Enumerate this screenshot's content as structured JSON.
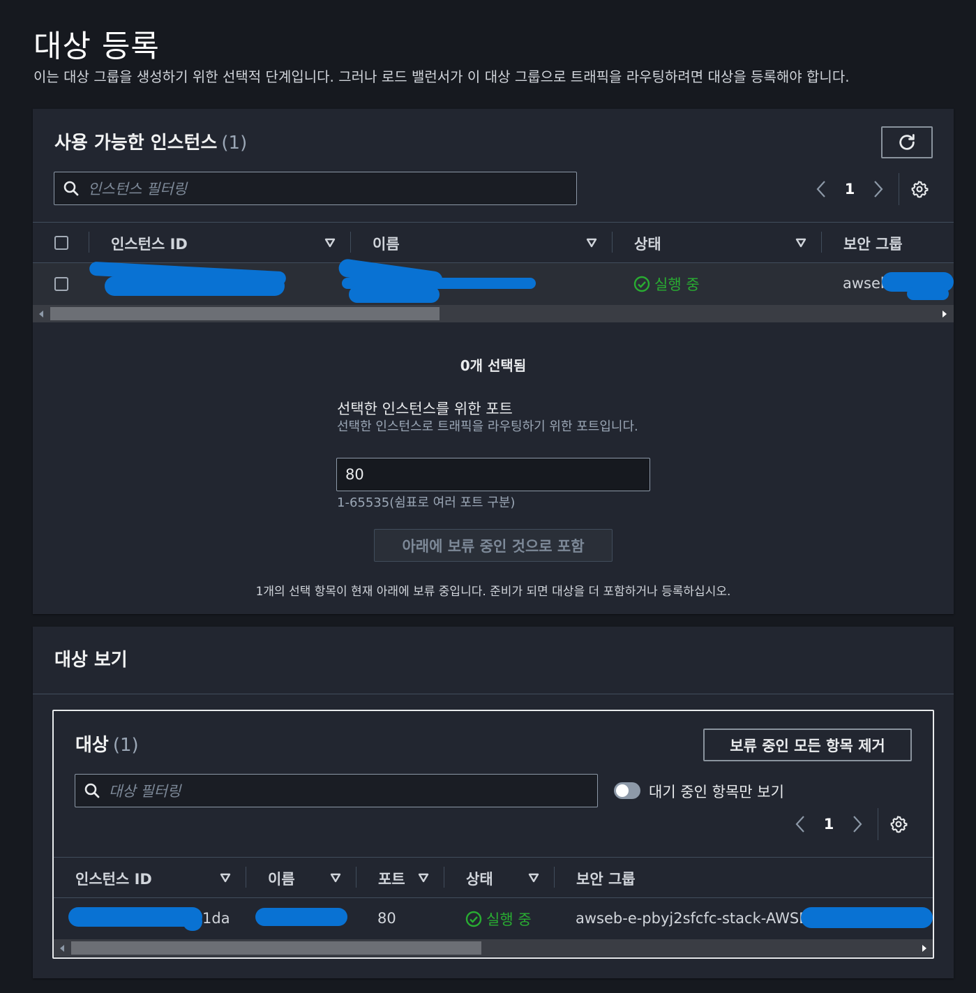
{
  "page": {
    "title": "대상 등록",
    "description": "이는 대상 그룹을 생성하기 위한 선택적 단계입니다. 그러나 로드 밸런서가 이 대상 그룹으로 트래픽을 라우팅하려면 대상을 등록해야 합니다."
  },
  "available": {
    "heading": "사용 가능한 인스턴스",
    "count": "(1)",
    "search_placeholder": "인스턴스 필터링",
    "page": "1",
    "columns": [
      "인스턴스 ID",
      "이름",
      "상태",
      "보안 그룹"
    ],
    "rows": [
      {
        "instance_id": "",
        "name": "",
        "status": "실행 중",
        "security_group": "awseb"
      }
    ]
  },
  "selection": {
    "selected_text": "0개 선택됨",
    "port_label": "선택한 인스턴스를 위한 포트",
    "port_desc": "선택한 인스턴스로 트래픽을 라우팅하기 위한 포트입니다.",
    "port_value": "80",
    "port_hint": "1-65535(쉼표로 여러 포트 구분)",
    "include_button": "아래에 보류 중인 것으로 포함",
    "pending_note": "1개의 선택 항목이 현재 아래에 보류 중입니다. 준비가 되면 대상을 더 포함하거나 등록하십시오."
  },
  "review": {
    "heading": "대상 보기",
    "targets_heading": "대상",
    "targets_count": "(1)",
    "remove_all_button": "보류 중인 모든 항목 제거",
    "search_placeholder": "대상 필터링",
    "toggle_label": "대기 중인 항목만 보기",
    "page": "1",
    "columns": [
      "인스턴스 ID",
      "이름",
      "포트",
      "상태",
      "보안 그룹"
    ],
    "rows": [
      {
        "instance_id_suffix": "1da",
        "port": "80",
        "status": "실행 중",
        "security_group": "awseb-e-pbyj2sfcfc-stack-AWSEB"
      }
    ]
  },
  "colors": {
    "background": "#16191f",
    "panel": "#222630",
    "status_ok": "#29ad32",
    "redaction": "#0972d3"
  },
  "icons": [
    "refresh-icon",
    "search-icon",
    "chevron-left-icon",
    "chevron-right-icon",
    "gear-icon",
    "sort-down-icon",
    "status-ok-icon"
  ]
}
